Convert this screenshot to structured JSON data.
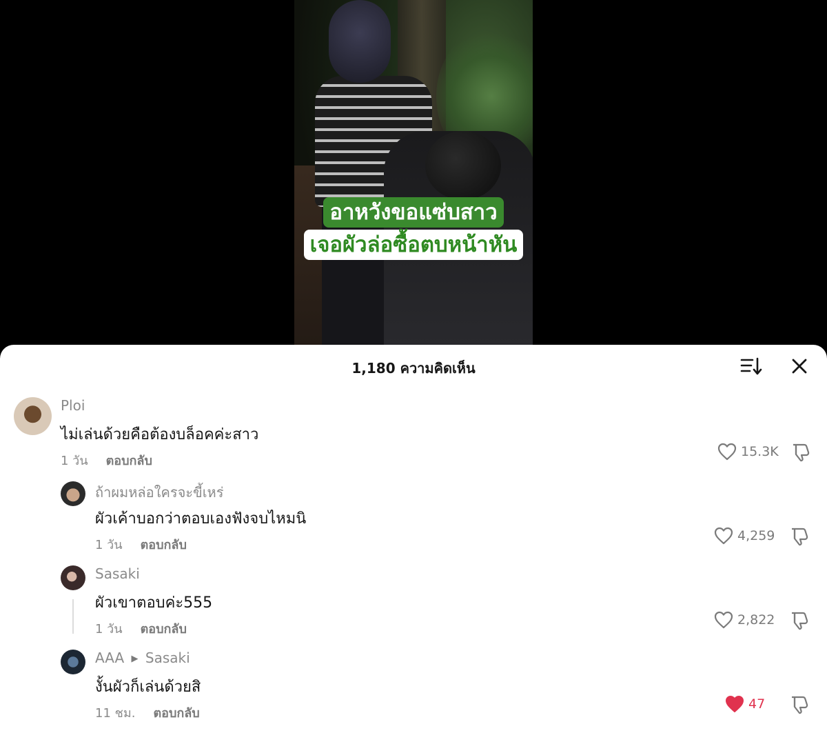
{
  "video": {
    "caption_line1": "อาหวังขอแซ่บสาว",
    "caption_line2": "เจอผัวล่อซื้อตบหน้าหัน",
    "caption_line1_bg": "#3a8a2e",
    "caption_line2_color": "#2f8a22"
  },
  "sheet": {
    "title": "1,180 ความคิดเห็น",
    "sort_icon": "sort-icon",
    "close_icon": "close-icon"
  },
  "comments": [
    {
      "username": "Ploi",
      "text": "ไม่เล่นด้วยคือต้องบล็อคค่ะสาว",
      "time": "1 วัน",
      "reply_label": "ตอบกลับ",
      "likes": "15.3K",
      "liked": false
    },
    {
      "username": "ถ้าผมหล่อใครจะขี้เหร่",
      "text": "ผัวเค้าบอกว่าตอบเองฟังจบไหมนิ",
      "time": "1 วัน",
      "reply_label": "ตอบกลับ",
      "likes": "4,259",
      "liked": false
    },
    {
      "username": "Sasaki",
      "text": "ผัวเขาตอบค่ะ555",
      "time": "1 วัน",
      "reply_label": "ตอบกลับ",
      "likes": "2,822",
      "liked": false
    },
    {
      "username": "AAA",
      "reply_to": "Sasaki",
      "text": "งั้นผัวก็เล่นด้วยสิ",
      "time": "11 ชม.",
      "reply_label": "ตอบกลับ",
      "likes": "47",
      "liked": true
    }
  ],
  "colors": {
    "like_active": "#e0324e",
    "muted_text": "#8a8a8a",
    "primary_text": "#161616"
  }
}
